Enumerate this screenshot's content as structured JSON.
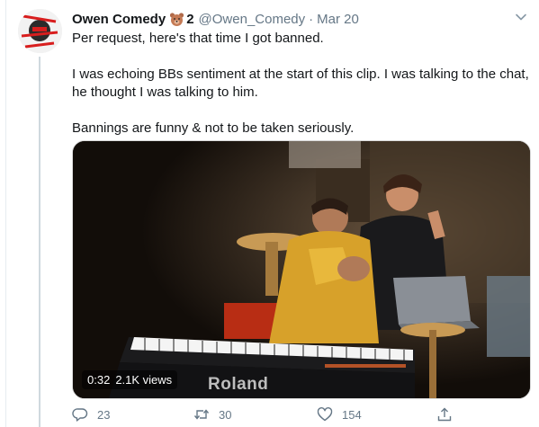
{
  "tweet": {
    "display_name": "Owen Comedy",
    "name_emoji": "bear-face-icon",
    "name_suffix": "2",
    "handle": "@Owen_Comedy",
    "separator": "·",
    "date": "Mar 20",
    "avatar_icon": "profile-avatar-icon",
    "paragraphs": [
      "Per request, here's that time I got banned.",
      "I was echoing BBs sentiment at the start of this clip. I was talking to the chat, he thought I was talking to him.",
      "Bannings are funny & not to be taken seriously."
    ],
    "video": {
      "duration": "0:32",
      "views": "2.1K views",
      "brand_text": "Roland"
    },
    "actions": {
      "replies": "23",
      "retweets": "30",
      "likes": "154"
    },
    "colors": {
      "text": "#14171a",
      "muted": "#657786",
      "thread_line": "#cfd9de"
    }
  }
}
